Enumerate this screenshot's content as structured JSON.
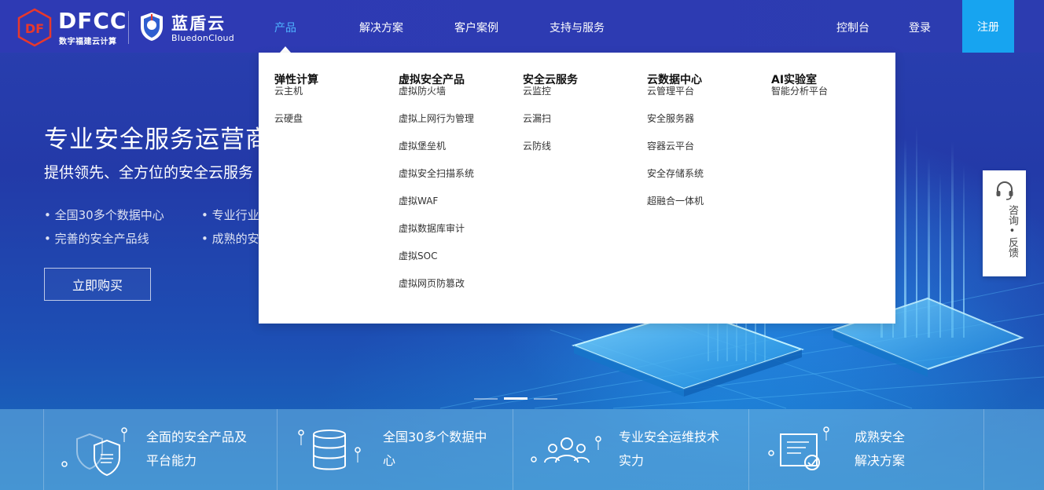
{
  "header": {
    "brand_logo": "DFCC",
    "brand_sub": "数字福建云计算",
    "partner_name": "蓝盾云",
    "partner_sub": "BluedonCloud",
    "nav": [
      "产品",
      "解决方案",
      "客户案例",
      "支持与服务"
    ],
    "console": "控制台",
    "login": "登录",
    "register": "注册",
    "accent": "#17a4f0"
  },
  "hero": {
    "title": "专业安全服务运营商",
    "subtitle": "提供领先、全方位的安全云服务",
    "bullets": [
      "• 全国30多个数据中心",
      "• 专业行业",
      "• 完善的安全产品线",
      "• 成熟的安"
    ],
    "buy": "立即购买"
  },
  "dropdown": {
    "columns": [
      {
        "title": "弹性计算",
        "items": [
          "云主机",
          "云硬盘"
        ]
      },
      {
        "title": "虚拟安全产品",
        "items": [
          "虚拟防火墙",
          "虚拟上网行为管理",
          "虚拟堡垒机",
          "虚拟安全扫描系统",
          "虚拟WAF",
          "虚拟数据库审计",
          "虚拟SOC",
          "虚拟网页防篡改"
        ]
      },
      {
        "title": "安全云服务",
        "items": [
          "云监控",
          "云漏扫",
          "云防线"
        ]
      },
      {
        "title": "云数据中心",
        "items": [
          "云管理平台",
          "安全服务器",
          "容器云平台",
          "安全存储系统",
          "超融合一体机"
        ]
      },
      {
        "title": "AI实验室",
        "items": [
          "智能分析平台"
        ]
      }
    ]
  },
  "carousel": {
    "count": 3,
    "active": 1
  },
  "features": [
    {
      "line1": "全面的安全产品及",
      "line2": "平台能力",
      "icon": "shield-icon"
    },
    {
      "line1": "全国30多个数据中",
      "line2": "心",
      "icon": "database-icon"
    },
    {
      "line1": "专业安全运维技术",
      "line2": "实力",
      "icon": "team-icon"
    },
    {
      "line1": "成熟安全",
      "line2": "解决方案",
      "icon": "document-check-icon"
    }
  ],
  "consult": {
    "text": "咨询•反馈",
    "icon": "headset-icon"
  }
}
